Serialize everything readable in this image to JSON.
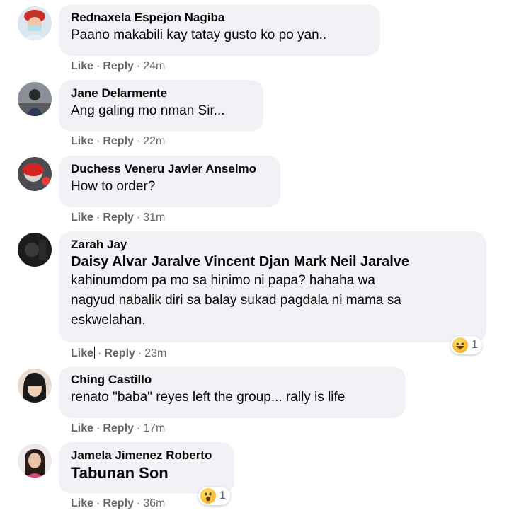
{
  "comments": [
    {
      "author": "Rednaxela Espejon Nagiba",
      "text": "Paano makabili kay tatay gusto ko po yan..",
      "like": "Like",
      "reply": "Reply",
      "time": "24m"
    },
    {
      "author": "Jane Delarmente",
      "text": "Ang galing mo nman Sir...",
      "like": "Like",
      "reply": "Reply",
      "time": "22m"
    },
    {
      "author": "Duchess Veneru Javier Anselmo",
      "text": "How to order?",
      "like": "Like",
      "reply": "Reply",
      "time": "31m"
    },
    {
      "author": "Zarah Jay",
      "mention": "Daisy Alvar Jaralve Vincent Djan Mark Neil Jaralve",
      "text_line1": "kahinumdom pa mo sa hinimo ni papa? hahaha wa",
      "text_line2": "nagyud nabalik diri sa balay sukad pagdala ni mama sa",
      "text_line3": "eskwelahan.",
      "like": "Like",
      "reply": "Reply",
      "time": "23m",
      "reaction_icon": "haha-emoji-icon",
      "reaction_count": "1"
    },
    {
      "author": "Ching Castillo",
      "text": "renato \"baba\" reyes left the group... rally is life",
      "like": "Like",
      "reply": "Reply",
      "time": "17m"
    },
    {
      "author": "Jamela Jimenez Roberto",
      "tag": "Tabunan Son",
      "like": "Like",
      "reply": "Reply",
      "time": "36m",
      "reaction_icon": "wow-emoji-icon",
      "reaction_count": "1"
    }
  ],
  "separator": "·",
  "colors": {
    "bubble": "#f0f2f5",
    "meta": "#65676b",
    "text": "#050505"
  }
}
